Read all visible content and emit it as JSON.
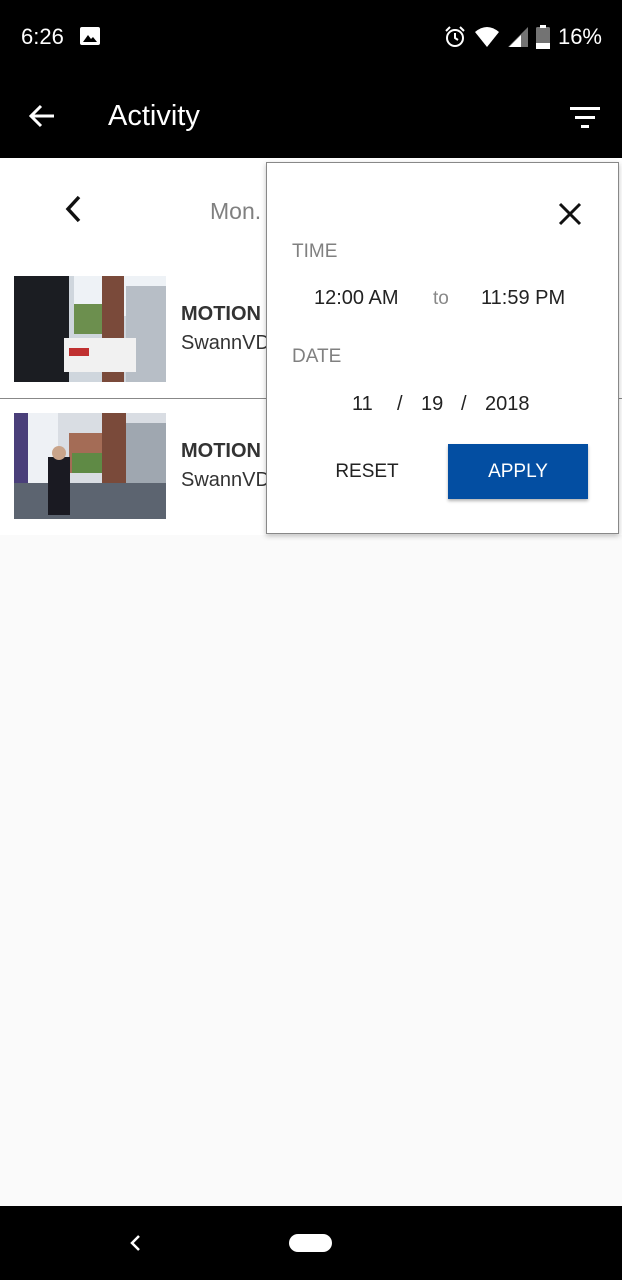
{
  "status_bar": {
    "time": "6:26",
    "battery": "16%"
  },
  "app_bar": {
    "title": "Activity",
    "icons": [
      "back-arrow-icon",
      "filter-icon"
    ]
  },
  "date_nav": {
    "label": "Mon."
  },
  "events": [
    {
      "type": "MOTION",
      "device": "SwannVD"
    },
    {
      "type": "MOTION",
      "device": "SwannVD"
    }
  ],
  "filter": {
    "time_label": "TIME",
    "time_from": "12:00 AM",
    "time_to_word": "to",
    "time_to": "11:59 PM",
    "date_label": "DATE",
    "month": "11",
    "day": "19",
    "year": "2018",
    "date_sep": "/",
    "reset_label": "RESET",
    "apply_label": "APPLY"
  },
  "colors": {
    "accent": "#034ea2",
    "bars": "#000000",
    "background": "#fafafa"
  }
}
